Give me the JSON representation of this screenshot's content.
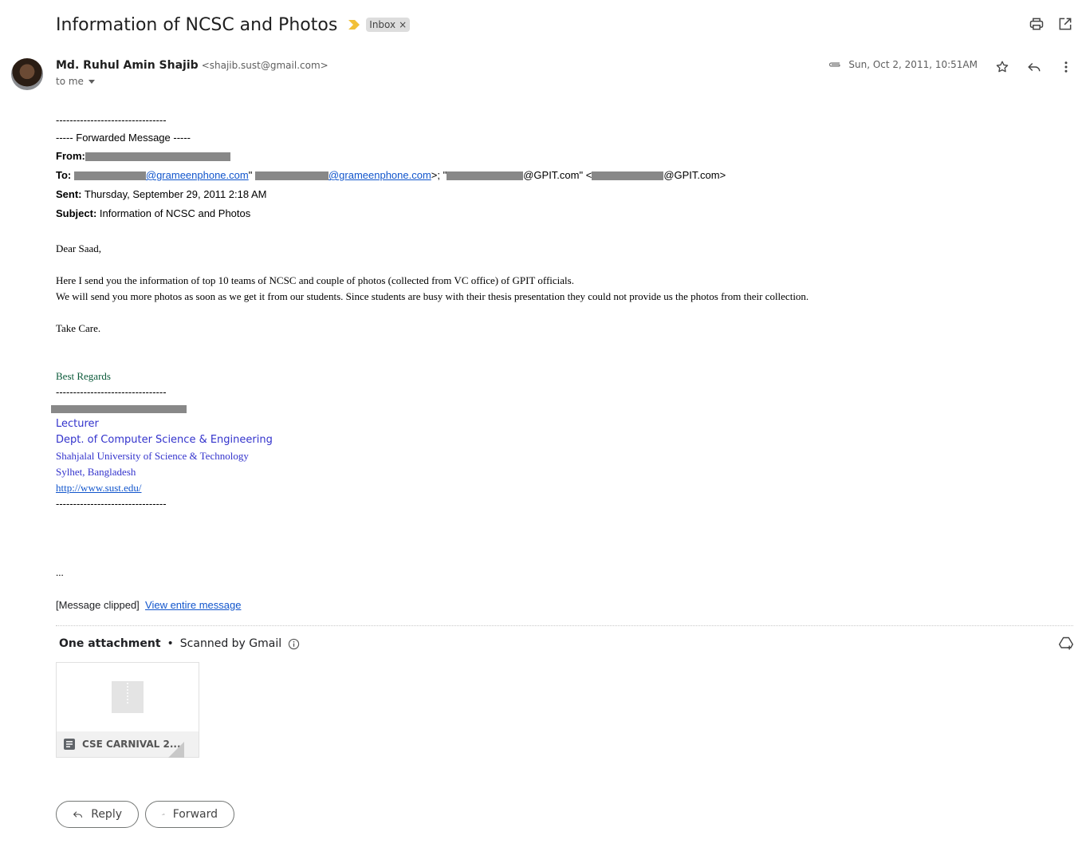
{
  "header": {
    "subject": "Information of NCSC and Photos",
    "label": "Inbox",
    "label_remove": "×"
  },
  "sender": {
    "name": "Md. Ruhul Amin Shajib",
    "email": "<shajib.sust@gmail.com>",
    "to": "to me",
    "date": "Sun, Oct 2, 2011, 10:51AM"
  },
  "body": {
    "dashes": "--------------------------------",
    "forwarded": "----- Forwarded Message -----",
    "from_label": "From:",
    "to_label": "To:",
    "to_link1": "@grameenphone.com",
    "to_text1": "\"",
    "to_link2": "@grameenphone.com",
    "to_text2": ">; \"",
    "to_text3": "@GPIT.com\" <",
    "to_text4": "@GPIT.com>",
    "sent_label": "Sent:",
    "sent_value": "Thursday, September 29, 2011 2:18 AM",
    "subject_label": "Subject:",
    "subject_value": "Information of NCSC and Photos",
    "greeting": "Dear Saad,",
    "para1": "Here I send you the information of top 10 teams of NCSC and couple of photos (collected from VC office) of GPIT officials.",
    "para2": "We will send you more photos as soon as we get it from our students. Since students are busy with their thesis presentation they could not provide us the photos from their collection.",
    "closing": "Take Care.",
    "regards": "Best Regards",
    "sig_title": "Lecturer",
    "sig_dept": "Dept. of Computer Science & Engineering",
    "sig_univ": "Shahjalal University of Science & Technology",
    "sig_city": "Sylhet, Bangladesh",
    "sig_url": "http://www.sust.edu/",
    "ellipsis": "..."
  },
  "clipped": {
    "text": "[Message clipped]",
    "link": "View entire message"
  },
  "attachments": {
    "heading": "One attachment",
    "bullet": "•",
    "scanned": "Scanned by Gmail",
    "file_name": "CSE CARNIVAL 2..."
  },
  "actions": {
    "reply": "Reply",
    "forward": "Forward"
  },
  "icons": [
    "print-icon",
    "open-in-new-window-icon",
    "attachment-clip-icon",
    "star-icon",
    "reply-icon",
    "more-vert-icon",
    "add-to-drive-icon",
    "info-icon",
    "document-icon",
    "zip-file-icon"
  ],
  "colors": {
    "link": "#1155cc",
    "signature_blue": "#3333cc",
    "signature_green": "#0b5a3a",
    "importance_marker": "#f2c037",
    "redaction": "#888888"
  }
}
